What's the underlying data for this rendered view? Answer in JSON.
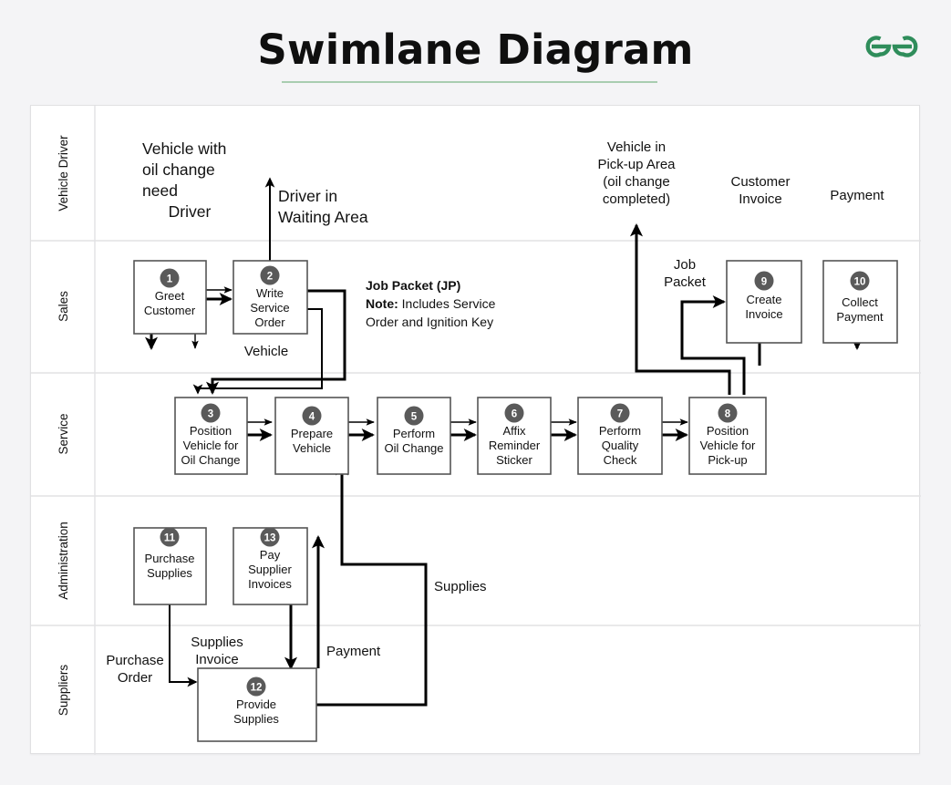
{
  "header": {
    "title": "Swimlane Diagram",
    "logo_name": "geeksforgeeks-logo",
    "accent_color": "#2f8d5b",
    "underline_color": "#a8cdb0"
  },
  "diagram": {
    "type": "swimlane",
    "lanes": [
      {
        "id": "vehicle-driver",
        "label": "Vehicle Driver"
      },
      {
        "id": "sales",
        "label": "Sales"
      },
      {
        "id": "service",
        "label": "Service"
      },
      {
        "id": "administration",
        "label": "Administration"
      },
      {
        "id": "suppliers",
        "label": "Suppliers"
      }
    ],
    "steps": [
      {
        "num": "1",
        "lane": "sales",
        "lines": [
          "Greet",
          "Customer"
        ]
      },
      {
        "num": "2",
        "lane": "sales",
        "lines": [
          "Write",
          "Service",
          "Order"
        ]
      },
      {
        "num": "3",
        "lane": "service",
        "lines": [
          "Position",
          "Vehicle for",
          "Oil Change"
        ]
      },
      {
        "num": "4",
        "lane": "service",
        "lines": [
          "Prepare",
          "Vehicle"
        ]
      },
      {
        "num": "5",
        "lane": "service",
        "lines": [
          "Perform",
          "Oil Change"
        ]
      },
      {
        "num": "6",
        "lane": "service",
        "lines": [
          "Affix",
          "Reminder",
          "Sticker"
        ]
      },
      {
        "num": "7",
        "lane": "service",
        "lines": [
          "Perform",
          "Quality",
          "Check"
        ]
      },
      {
        "num": "8",
        "lane": "service",
        "lines": [
          "Position",
          "Vehicle for",
          "Pick-up"
        ]
      },
      {
        "num": "9",
        "lane": "sales",
        "lines": [
          "Create",
          "Invoice"
        ]
      },
      {
        "num": "10",
        "lane": "sales",
        "lines": [
          "Collect",
          "Payment"
        ]
      },
      {
        "num": "11",
        "lane": "administration",
        "lines": [
          "Purchase",
          "Supplies"
        ]
      },
      {
        "num": "12",
        "lane": "suppliers",
        "lines": [
          "Provide",
          "Supplies"
        ]
      },
      {
        "num": "13",
        "lane": "administration",
        "lines": [
          "Pay",
          "Supplier",
          "Invoices"
        ]
      }
    ],
    "flow_labels": [
      {
        "id": "vehicle-with-oil-change-need",
        "lines": [
          "Vehicle with",
          "oil change",
          "need"
        ]
      },
      {
        "id": "driver",
        "lines": [
          "Driver"
        ]
      },
      {
        "id": "driver-in-waiting-area",
        "lines": [
          "Driver in",
          "Waiting Area"
        ]
      },
      {
        "id": "vehicle",
        "lines": [
          "Vehicle"
        ]
      },
      {
        "id": "vehicle-in-pickup-area",
        "lines": [
          "Vehicle in",
          "Pick-up Area",
          "(oil change",
          "completed)"
        ]
      },
      {
        "id": "customer-invoice",
        "lines": [
          "Customer",
          "Invoice"
        ]
      },
      {
        "id": "payment-top",
        "lines": [
          "Payment"
        ]
      },
      {
        "id": "job-packet",
        "lines": [
          "Job",
          "Packet"
        ]
      },
      {
        "id": "supplies",
        "lines": [
          "Supplies"
        ]
      },
      {
        "id": "purchase-order",
        "lines": [
          "Purchase",
          "Order"
        ]
      },
      {
        "id": "supplies-invoice",
        "lines": [
          "Supplies",
          "Invoice"
        ]
      },
      {
        "id": "payment-supplier",
        "lines": [
          "Payment"
        ]
      }
    ],
    "note": {
      "title": "Job Packet (JP)",
      "label": "Note:",
      "body_line1": " Includes Service",
      "body_line2": "Order and Ignition Key"
    }
  }
}
